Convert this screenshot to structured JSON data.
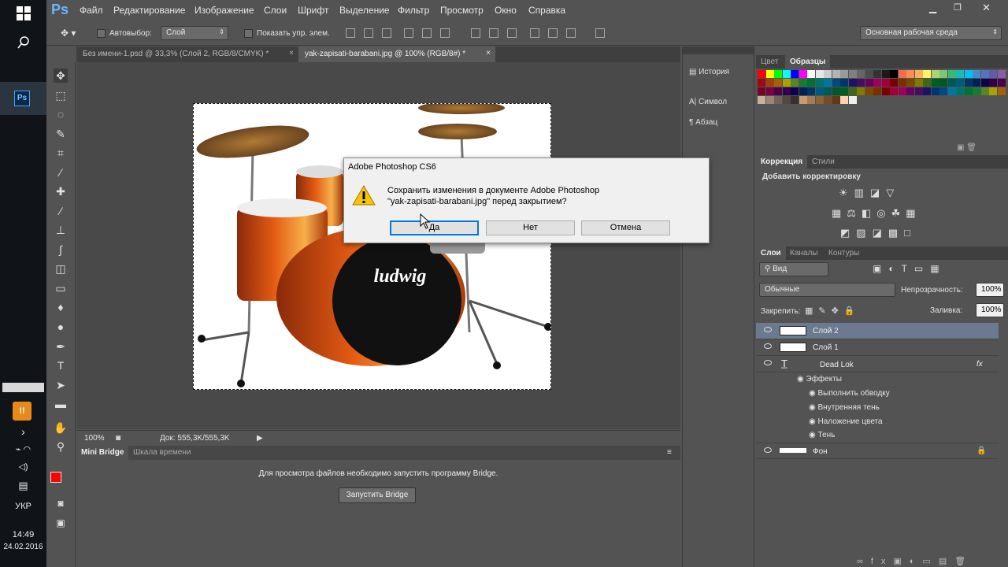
{
  "taskbar": {
    "keyboard_lang": "УКР",
    "time": "14:49",
    "date": "24.02.2016"
  },
  "app": {
    "logo": "Ps",
    "menu": [
      "Файл",
      "Редактирование",
      "Изображение",
      "Слои",
      "Шрифт",
      "Выделение",
      "Фильтр",
      "Просмотр",
      "Окно",
      "Справка"
    ],
    "workspace": "Основная рабочая среда"
  },
  "options": {
    "autoselect_label": "Автовыбор:",
    "autoselect_value": "Слой",
    "show_controls_label": "Показать упр. элем."
  },
  "tabs": [
    {
      "label": "Без имени-1.psd @ 33,3% (Слой 2, RGB/8/CMYK) *"
    },
    {
      "label": "yak-zapisati-barabani.jpg @ 100% (RGB/8#) *"
    }
  ],
  "status": {
    "zoom": "100%",
    "doc": "Док: 555,3K/555,3K"
  },
  "bridge": {
    "tabs": [
      "Mini Bridge",
      "Шкала времени"
    ],
    "message": "Для просмотра файлов необходимо запустить программу Bridge.",
    "button": "Запустить Bridge"
  },
  "midpanel": {
    "items": [
      "История",
      "Символ",
      "Абзац"
    ]
  },
  "swatches_panel": {
    "tabs": [
      "Цвет",
      "Образцы"
    ],
    "colors": [
      "#ff0000",
      "#ffff00",
      "#00ff00",
      "#00ffff",
      "#0000ff",
      "#ff00ff",
      "#ffffff",
      "#e6e6e6",
      "#cccccc",
      "#b3b3b3",
      "#999999",
      "#808080",
      "#666666",
      "#4d4d4d",
      "#333333",
      "#1a1a1a",
      "#000000",
      "#f26c4f",
      "#f68e56",
      "#fbaf5d",
      "#fff568",
      "#acd372",
      "#7cc576",
      "#3bb878",
      "#1abbb4",
      "#00bff3",
      "#438ccb",
      "#5574b9",
      "#605ca8",
      "#855fa8",
      "#a763a8",
      "#f06ea9",
      "#f26d7d"
    ]
  },
  "adjust_panel": {
    "tabs": [
      "Коррекция",
      "Стили"
    ],
    "heading": "Добавить корректировку"
  },
  "layers_panel": {
    "tabs": [
      "Слои",
      "Каналы",
      "Контуры"
    ],
    "filter": "Вид",
    "blend": "Обычные",
    "opacity_label": "Непрозрачность:",
    "opacity": "100%",
    "lock_label": "Закрепить:",
    "fill_label": "Заливка:",
    "fill": "100%",
    "layers": [
      {
        "name": "Слой 2",
        "selected": true
      },
      {
        "name": "Слой 1",
        "selected": false
      },
      {
        "name": "Dead Lok",
        "selected": false,
        "fx": "fx"
      }
    ],
    "effects_label": "Эффекты",
    "effects": [
      "Выполнить обводку",
      "Внутренняя тень",
      "Наложение цвета",
      "Тень"
    ],
    "background": "Фон"
  },
  "dialog": {
    "title": "Adobe Photoshop CS6",
    "line1": "Сохранить изменения в документе Adobe Photoshop",
    "line2": "\"yak-zapisati-barabani.jpg\" перед закрытием?",
    "yes": "Да",
    "no": "Нет",
    "cancel": "Отмена"
  },
  "drum_brand": "ludwig"
}
